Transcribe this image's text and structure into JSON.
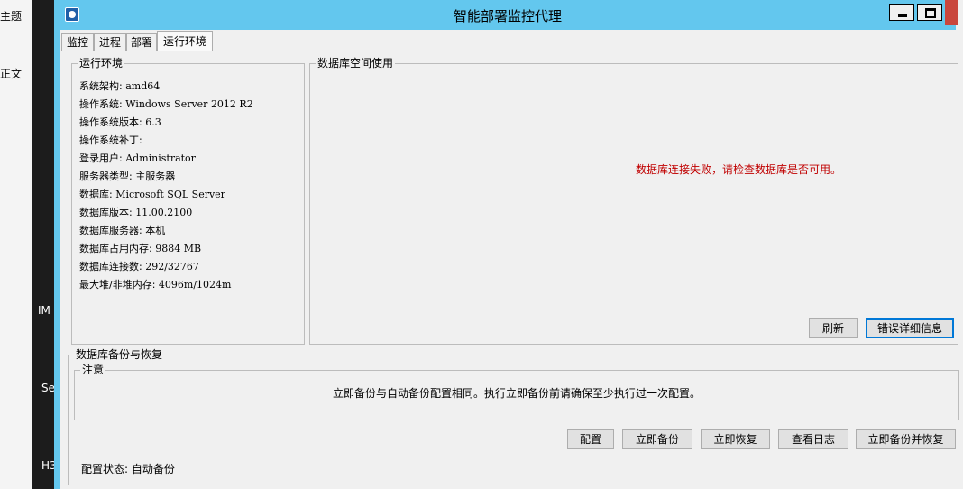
{
  "background": {
    "labels": [
      "主题",
      "正文",
      "IM",
      "Se",
      "H3"
    ]
  },
  "window": {
    "title": "智能部署监控代理",
    "tabs": [
      "监控",
      "进程",
      "部署",
      "运行环境"
    ],
    "active_tab": "运行环境"
  },
  "env": {
    "title": "运行环境",
    "items": [
      {
        "key": "系统架构:",
        "value": "amd64"
      },
      {
        "key": "操作系统:",
        "value": "Windows Server 2012 R2"
      },
      {
        "key": "操作系统版本:",
        "value": "6.3"
      },
      {
        "key": "操作系统补丁:",
        "value": ""
      },
      {
        "key": "登录用户:",
        "value": "Administrator"
      },
      {
        "key": "服务器类型:",
        "value": "主服务器"
      },
      {
        "key": "数据库:",
        "value": "Microsoft SQL Server"
      },
      {
        "key": "数据库版本:",
        "value": "11.00.2100"
      },
      {
        "key": "数据库服务器:",
        "value": "本机"
      },
      {
        "key": "数据库占用内存:",
        "value": "9884 MB"
      },
      {
        "key": "数据库连接数:",
        "value": "292/32767"
      },
      {
        "key": "最大堆/非堆内存:",
        "value": "4096m/1024m"
      }
    ]
  },
  "db_space": {
    "title": "数据库空间使用",
    "error": "数据库连接失败，请检查数据库是否可用。",
    "refresh_label": "刷新",
    "details_label": "错误详细信息"
  },
  "backup": {
    "title": "数据库备份与恢复",
    "note_title": "注意",
    "note_text": "立即备份与自动备份配置相同。执行立即备份前请确保至少执行过一次配置。",
    "buttons": {
      "config": "配置",
      "backup_now": "立即备份",
      "restore_now": "立即恢复",
      "view_log": "查看日志",
      "backup_restore": "立即备份并恢复"
    },
    "status": "配置状态: 自动备份"
  },
  "colors": {
    "titlebar": "#63c7ee",
    "error_text": "#c00000",
    "close": "#c9463d"
  }
}
